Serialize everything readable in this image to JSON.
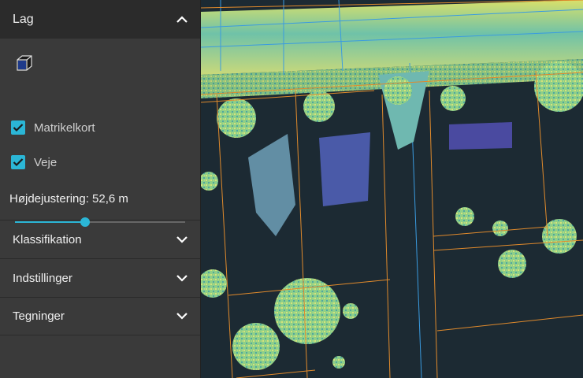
{
  "panel": {
    "layers_title": "Lag",
    "layers": [
      {
        "label": "Matrikelkort",
        "checked": true
      },
      {
        "label": "Veje",
        "checked": true
      }
    ],
    "height_adjust": {
      "label": "Højdejustering: 52,6 m",
      "fraction": 0.41
    },
    "sections": [
      {
        "label": "Klassifikation",
        "icon": "chevron-down-icon"
      },
      {
        "label": "Indstillinger",
        "icon": "chevron-down-icon"
      },
      {
        "label": "Tegninger",
        "icon": "chevron-down-icon"
      }
    ],
    "layers_icon": "chevron-up-icon",
    "cube_icon": "cube-icon"
  },
  "colors": {
    "accent": "#2bb6d6",
    "panel_bg": "#3a3a3a",
    "header_bg": "#2b2b2b",
    "map_bg": "#1c2a33",
    "parcel_line": "#e08a2c",
    "road_line": "#3a9be0"
  }
}
